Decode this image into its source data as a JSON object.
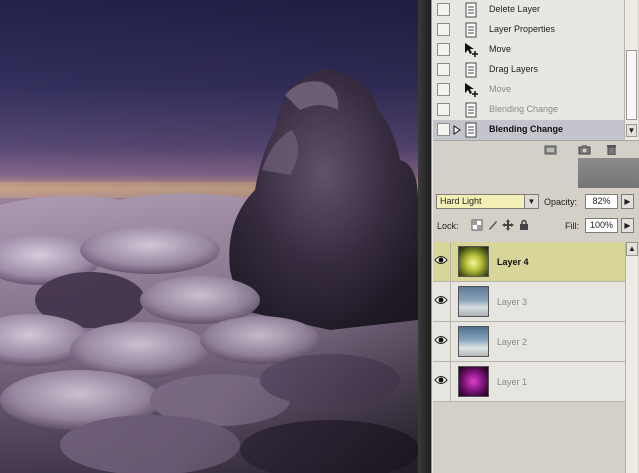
{
  "history": {
    "items": [
      {
        "label": "Delete Layer",
        "icon": "document-icon",
        "state": "normal"
      },
      {
        "label": "Layer Properties",
        "icon": "document-icon",
        "state": "normal"
      },
      {
        "label": "Move",
        "icon": "move-tool-icon",
        "state": "normal"
      },
      {
        "label": "Drag Layers",
        "icon": "document-icon",
        "state": "normal"
      },
      {
        "label": "Move",
        "icon": "move-tool-icon",
        "state": "greyed"
      },
      {
        "label": "Blending Change",
        "icon": "document-icon",
        "state": "greyed"
      },
      {
        "label": "Blending Change",
        "icon": "document-icon",
        "state": "active"
      }
    ],
    "footer_icons": [
      "new-snapshot-icon",
      "camera-icon",
      "trash-icon"
    ]
  },
  "layers": {
    "blend_mode": "Hard Light",
    "opacity_label": "Opacity:",
    "opacity_value": "82%",
    "lock_label": "Lock:",
    "fill_label": "Fill:",
    "fill_value": "100%",
    "items": [
      {
        "name": "Layer 4",
        "active": true,
        "visible": true,
        "thumb": "yellow-glow"
      },
      {
        "name": "Layer 3",
        "active": false,
        "visible": true,
        "thumb": "sky"
      },
      {
        "name": "Layer 2",
        "active": false,
        "visible": true,
        "thumb": "sky"
      },
      {
        "name": "Layer 1",
        "active": false,
        "visible": true,
        "thumb": "magenta-glow"
      }
    ]
  },
  "colors": {
    "panel_bg": "#d4d0c8",
    "active_layer": "#d7d598",
    "active_history": "#c4c5cc",
    "blend_field": "#f2f0b4"
  }
}
